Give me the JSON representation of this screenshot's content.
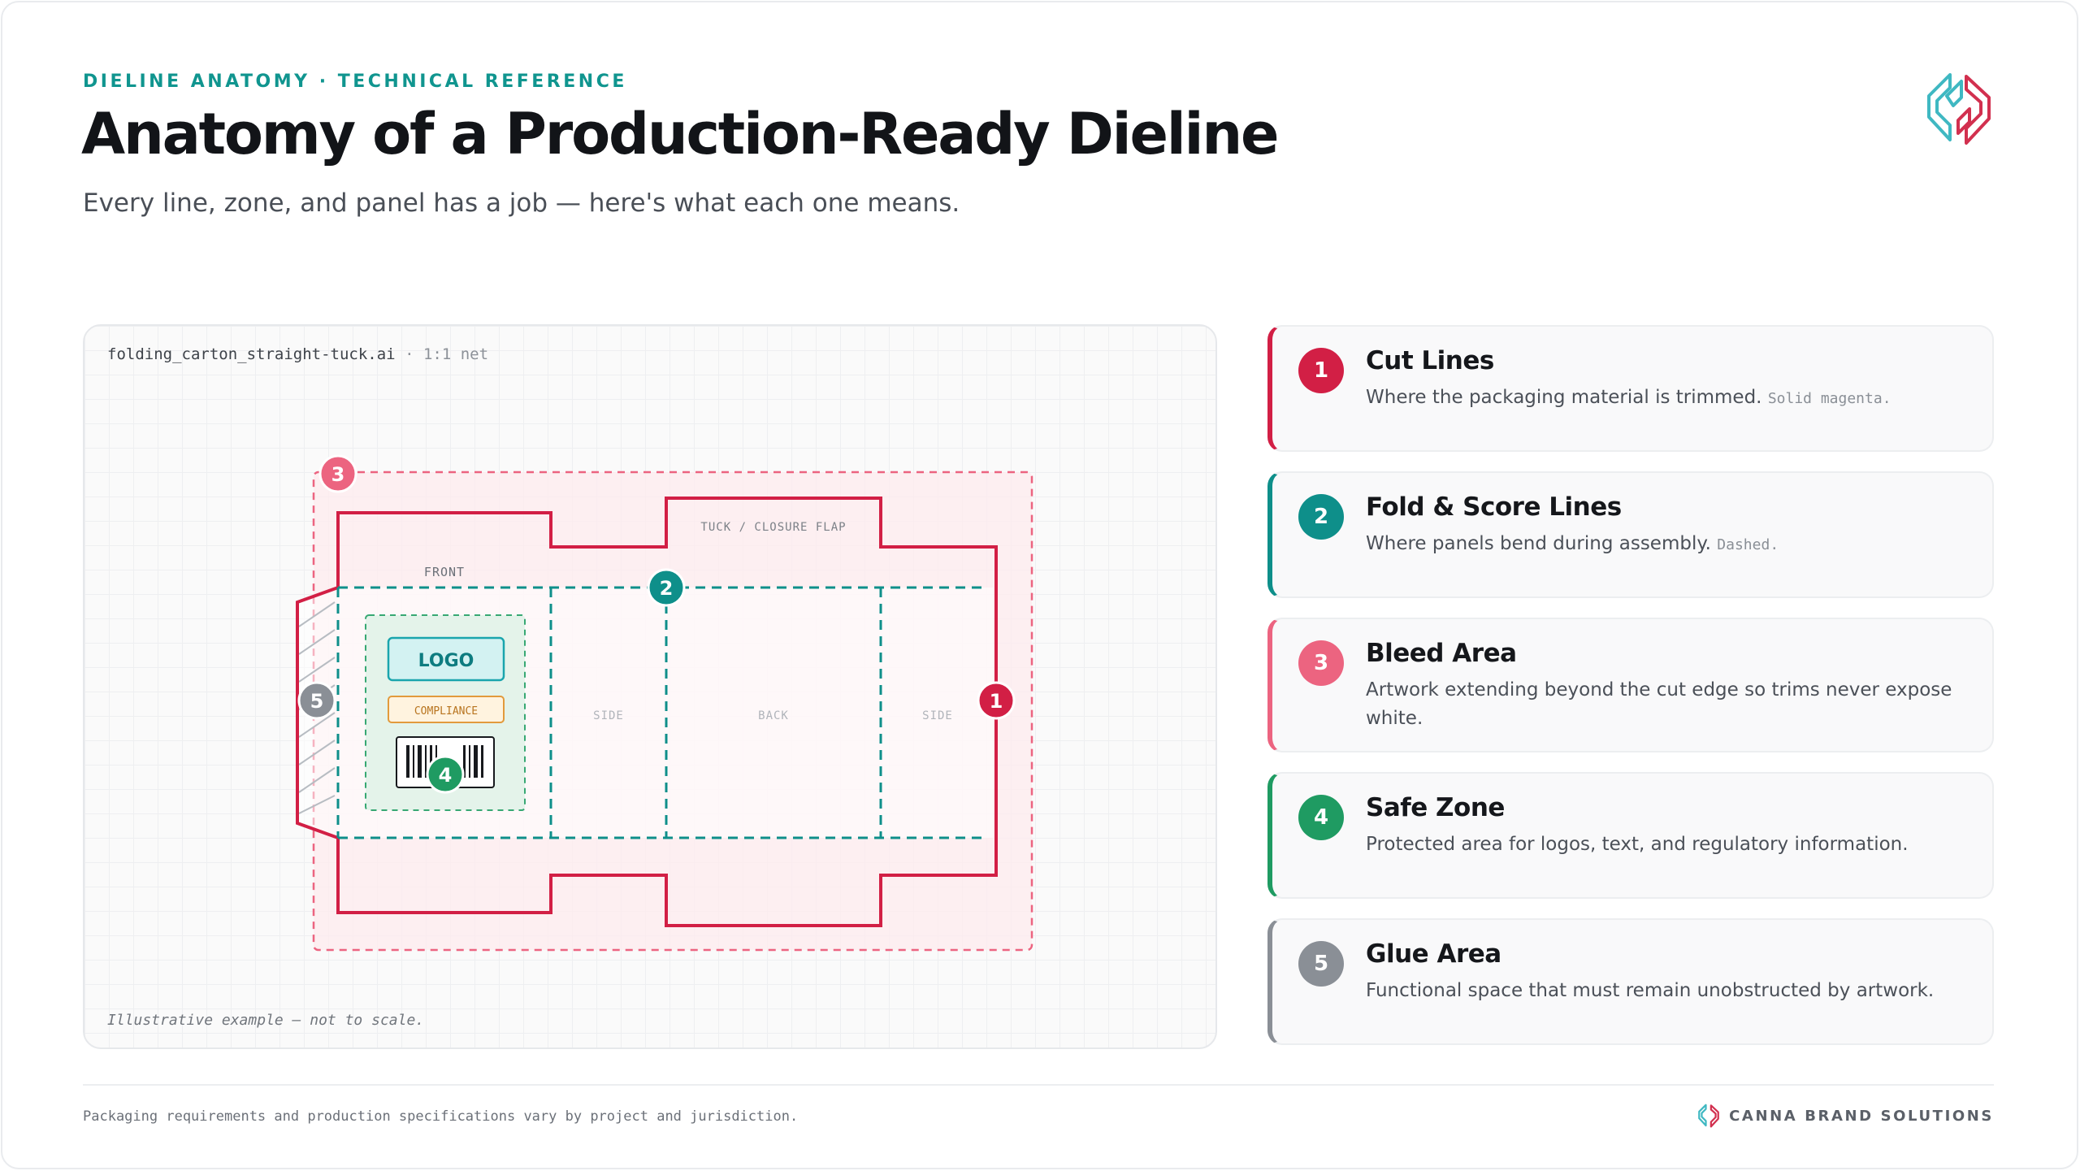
{
  "header": {
    "eyebrow": "DIELINE ANATOMY · TECHNICAL REFERENCE",
    "title": "Anatomy of a Production-Ready Dieline",
    "subtitle": "Every line, zone, and panel has a job — here's what each one means."
  },
  "diagram": {
    "file_name": "folding_carton_straight-tuck.ai",
    "file_scale": "· 1:1 net",
    "panels": {
      "tuck_flap": "TUCK / CLOSURE FLAP",
      "front": "FRONT",
      "side_left": "SIDE",
      "back": "BACK",
      "side_right": "SIDE"
    },
    "safe_zone_items": {
      "logo": "LOGO",
      "compliance": "COMPLIANCE"
    },
    "markers": [
      "1",
      "2",
      "3",
      "4",
      "5"
    ],
    "note": "Illustrative example — not to scale."
  },
  "legend": [
    {
      "number": "1",
      "title": "Cut Lines",
      "description": "Where the packaging material is trimmed.",
      "style_note": "Solid magenta.",
      "color": "#d21f45"
    },
    {
      "number": "2",
      "title": "Fold & Score Lines",
      "description": "Where panels bend during assembly.",
      "style_note": "Dashed.",
      "color": "#0e8f8a"
    },
    {
      "number": "3",
      "title": "Bleed Area",
      "description": "Artwork extending beyond the cut edge so trims never expose white.",
      "style_note": "",
      "color": "#ec6480"
    },
    {
      "number": "4",
      "title": "Safe Zone",
      "description": "Protected area for logos, text, and regulatory information.",
      "style_note": "",
      "color": "#1f9b62"
    },
    {
      "number": "5",
      "title": "Glue Area",
      "description": "Functional space that must remain unobstructed by artwork.",
      "style_note": "",
      "color": "#8a8f96"
    }
  ],
  "colors": {
    "cut": "#d21f45",
    "fold": "#0e8f8a",
    "bleed": "#ec6480",
    "safe": "#1f9b62",
    "glue": "#8a8f96",
    "accent": "#10958f"
  },
  "footer": {
    "disclaimer": "Packaging requirements and production specifications vary by project and jurisdiction.",
    "brand": "CANNA BRAND SOLUTIONS"
  }
}
